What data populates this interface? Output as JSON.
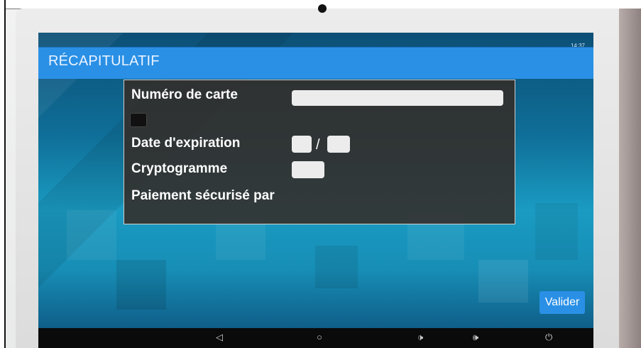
{
  "screen": {
    "status_time": "14:37",
    "header_title": "RÉCAPITULATIF",
    "form": {
      "card_number_label": "Numéro de carte",
      "expiry_label": "Date d'expiration",
      "expiry_separator": "/",
      "cvv_label": "Cryptogramme",
      "secure_payment_label": "Paiement sécurisé par"
    },
    "validate_label": "Valider"
  },
  "nav": {
    "back_icon": "◁",
    "home_icon": "○",
    "volume_down_icon": "🕩",
    "volume_up_icon": "🕪",
    "power_icon": "⏻"
  },
  "colors": {
    "header": "#2a90e6",
    "button": "#2a90e6",
    "panel": "#342c28"
  }
}
